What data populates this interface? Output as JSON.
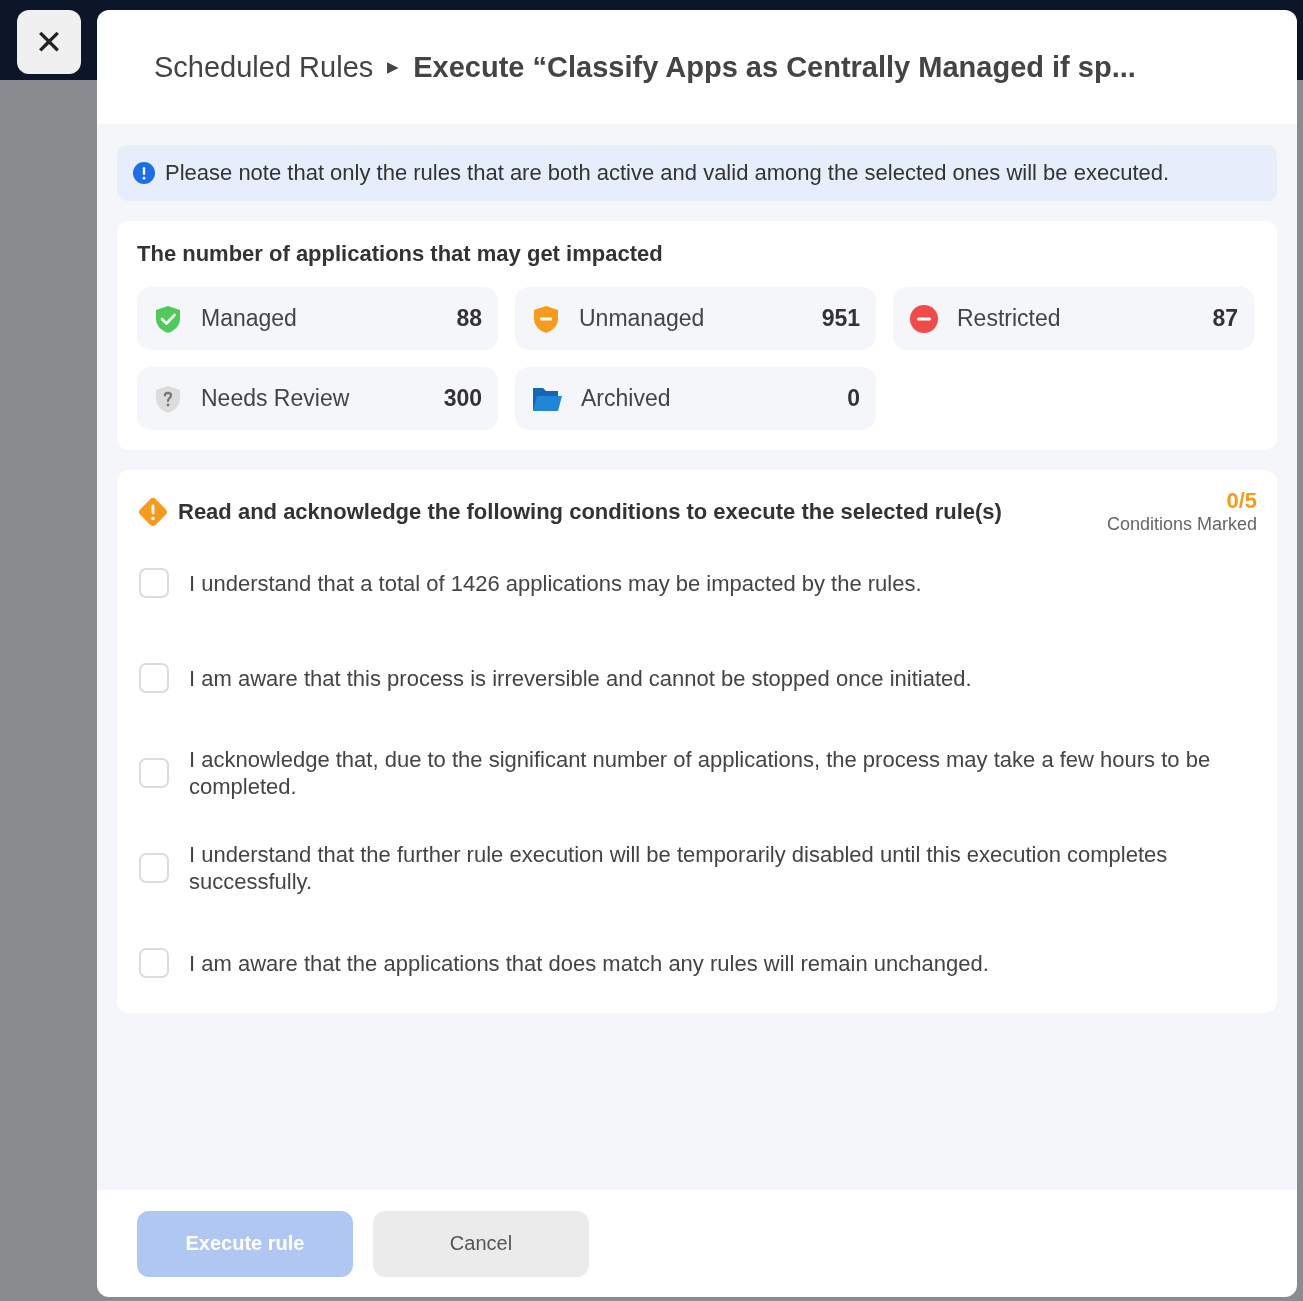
{
  "close_button": {
    "label": "✕"
  },
  "breadcrumb": {
    "parent": "Scheduled Rules",
    "separator": "▶",
    "current": "Execute “Classify Apps as Centrally Managed if sp..."
  },
  "notice": {
    "text": "Please note that only the rules that are both active and valid among the selected ones will be executed."
  },
  "impact": {
    "title": "The number of applications that may get impacted",
    "stats": [
      {
        "kind": "managed",
        "label": "Managed",
        "count": "88"
      },
      {
        "kind": "unmanaged",
        "label": "Unmanaged",
        "count": "951"
      },
      {
        "kind": "restricted",
        "label": "Restricted",
        "count": "87"
      },
      {
        "kind": "review",
        "label": "Needs Review",
        "count": "300"
      },
      {
        "kind": "archived",
        "label": "Archived",
        "count": "0"
      }
    ]
  },
  "conditions": {
    "title": "Read and acknowledge the following conditions to execute the selected rule(s)",
    "counter": "0/5",
    "counter_label": "Conditions Marked",
    "items": [
      {
        "text": "I understand that a total of 1426 applications may be impacted by the rules.",
        "checked": false
      },
      {
        "text": "I am aware that this process is irreversible and cannot be stopped once initiated.",
        "checked": false
      },
      {
        "text": "I acknowledge that, due to the significant number of applications, the process may take a few hours to be completed.",
        "checked": false
      },
      {
        "text": "I understand that the further rule execution will be temporarily disabled until this execution completes successfully.",
        "checked": false
      },
      {
        "text": "I am aware that the applications that does match any rules will remain unchanged.",
        "checked": false
      }
    ]
  },
  "buttons": [
    {
      "kind": "primary",
      "label": "Execute rule",
      "disabled": true
    },
    {
      "kind": "secondary",
      "label": "Cancel",
      "disabled": false
    }
  ]
}
